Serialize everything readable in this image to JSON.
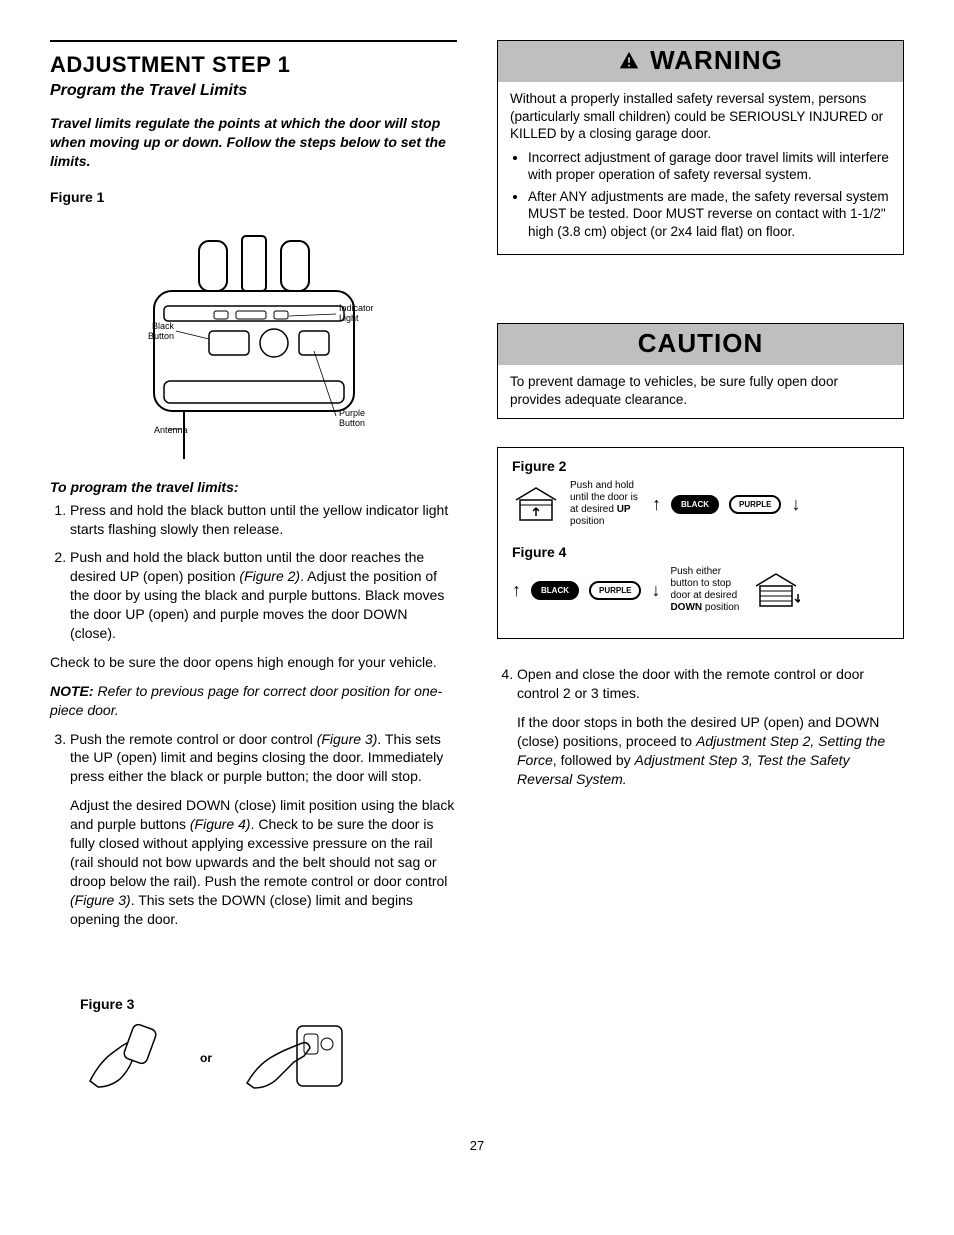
{
  "left": {
    "heading": "ADJUSTMENT STEP 1",
    "subheading": "Program the Travel Limits",
    "intro": "Travel limits regulate the points at which the door will stop when moving up or down. Follow the steps below to set the limits.",
    "figure1_label": "Figure 1",
    "fig1_labels": {
      "black_button": "Black Button",
      "indicator_light": "Indicator Light",
      "antenna": "Antenna",
      "purple_button": "Purple Button"
    },
    "program_heading": "To program the travel limits:",
    "step1": "Press and hold the black button until the yellow indicator light starts flashing slowly then release.",
    "step2_a": "Push and hold the black button until the door reaches the desired UP (open) position ",
    "step2_ref": "(Figure 2)",
    "step2_b": ". Adjust the position of the door by using the black and purple buttons. Black moves the door UP (open) and purple moves the door DOWN (close).",
    "check_para": "Check to be sure the door opens high enough for your vehicle.",
    "note_label": "NOTE:",
    "note_body": " Refer to previous page for correct door position for one-piece door.",
    "step3_a": "Push the remote control or door control ",
    "step3_ref1": "(Figure 3)",
    "step3_b": ". This sets the UP (open) limit and begins closing the door. Immediately press either the black or purple button; the door will stop.",
    "step3_c1": "Adjust the desired DOWN (close) limit position using the black and purple buttons ",
    "step3_ref2": "(Figure 4)",
    "step3_c2": ". Check to be sure the door is fully closed without applying excessive pressure on the rail (rail should not bow upwards and the belt should not sag or droop below the rail). Push the remote control or door control ",
    "step3_ref3": "(Figure 3)",
    "step3_c3": ". This sets the DOWN (close) limit and begins opening the door.",
    "figure3_label": "Figure 3",
    "or": "or"
  },
  "right": {
    "warning_title": "WARNING",
    "warning_text": "Without a properly installed safety reversal system, persons (particularly small children) could be SERIOUSLY INJURED or KILLED by a closing garage door.",
    "warning_b1": "Incorrect adjustment of garage door travel limits will interfere with proper operation of safety reversal system.",
    "warning_b2": "After ANY adjustments are made, the safety reversal system MUST be tested. Door MUST reverse on contact with 1-1/2\" high (3.8 cm) object (or 2x4 laid flat) on floor.",
    "caution_title": "CAUTION",
    "caution_text": "To prevent damage to vehicles, be sure fully open door provides adequate clearance.",
    "figure2_label": "Figure 2",
    "fig2_text_a": "Push and hold until the door is at desired ",
    "fig2_text_up": "UP",
    "fig2_text_b": " position",
    "black_btn": "BLACK",
    "purple_btn": "PURPLE",
    "figure4_label": "Figure 4",
    "fig4_text_a": "Push either button to stop door at desired ",
    "fig4_text_down": "DOWN",
    "fig4_text_b": " position",
    "step4_a": "Open and close the door with the remote control or door control 2 or 3 times.",
    "step4_b1": "If the door stops in both the desired UP (open) and DOWN (close) positions, proceed to ",
    "step4_ref1": "Adjustment Step 2, Setting the Force",
    "step4_b2": ", followed by ",
    "step4_ref2": "Adjustment Step 3, Test the Safety Reversal System.",
    "pagenum": "27"
  }
}
